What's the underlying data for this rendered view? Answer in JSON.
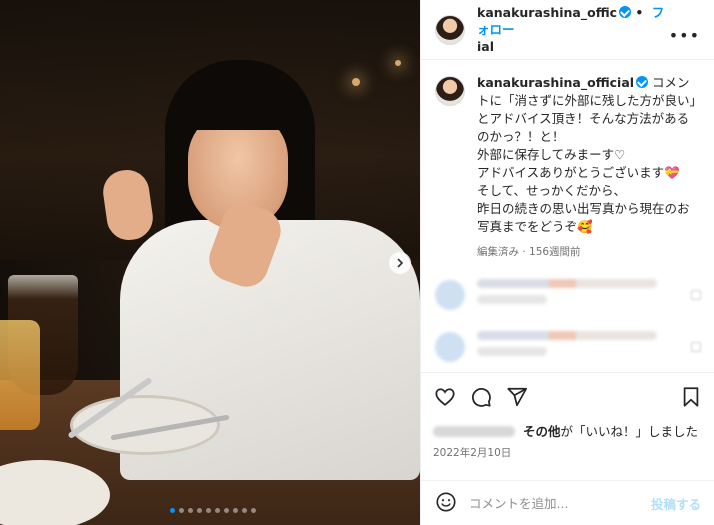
{
  "post": {
    "username": "kanakurashina_official",
    "header_name_line1": "kanakurashina_offic",
    "header_name_line2": "ial",
    "follow_label": "フォロー",
    "more_label": "•••",
    "caption_username": "kanakurashina_official",
    "caption_text": " コメントに「消さずに外部に残した方が良い」とアドバイス頂き！そんな方法があるのかっ？！と！\n外部に保存してみまーす♡\nアドバイスありがとうございます💝\nそして、せっかくだから、\n昨日の続きの思い出写真から現在のお写真までをどうぞ🥰",
    "caption_meta": "編集済み · 156週間前",
    "likes_suffix": "その他",
    "likes_text": "が「いいね！」しました",
    "date": "2022年2月10日",
    "comment_placeholder": "コメントを追加...",
    "post_button": "投稿する"
  },
  "carousel": {
    "total": 10,
    "current": 1
  },
  "icons": {
    "verified": "verified-badge-icon",
    "like": "heart-icon",
    "comment": "comment-icon",
    "share": "share-icon",
    "save": "bookmark-icon",
    "emoji": "emoji-icon",
    "next": "chevron-right-icon"
  },
  "colors": {
    "accent": "#0095f6",
    "text": "#262626",
    "muted": "#737373"
  }
}
